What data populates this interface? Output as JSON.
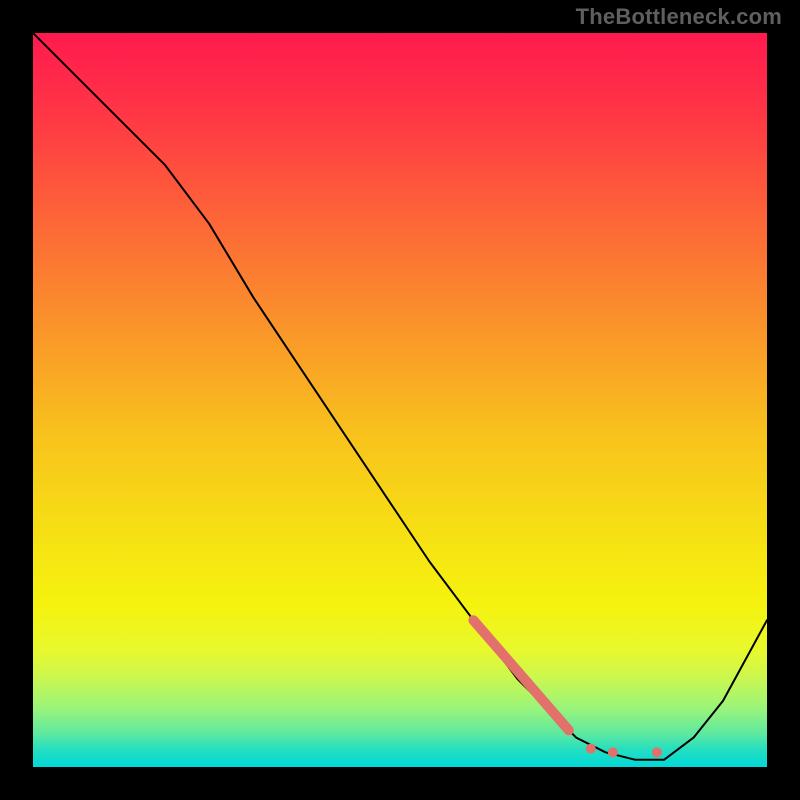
{
  "watermark": "TheBottleneck.com",
  "chart_data": {
    "type": "line",
    "title": "",
    "xlabel": "",
    "ylabel": "",
    "xlim": [
      0,
      100
    ],
    "ylim": [
      0,
      100
    ],
    "grid": false,
    "legend": false,
    "series": [
      {
        "name": "bottleneck-curve",
        "x": [
          0,
          4,
          10,
          18,
          24,
          30,
          36,
          42,
          48,
          54,
          60,
          66,
          70,
          74,
          78,
          82,
          86,
          90,
          94,
          100
        ],
        "y": [
          100,
          96,
          90,
          82,
          74,
          64,
          55,
          46,
          37,
          28,
          20,
          12,
          8,
          4,
          2,
          1,
          1,
          4,
          9,
          20
        ]
      }
    ],
    "markers": [
      {
        "name": "highlight-segment",
        "shape": "thick-line",
        "color": "#E2716C",
        "width": 10,
        "x": [
          60,
          73
        ],
        "y": [
          20,
          5
        ]
      },
      {
        "name": "highlight-dots",
        "shape": "dots",
        "color": "#E2716C",
        "radius": 5,
        "points": [
          {
            "x": 76,
            "y": 2.5
          },
          {
            "x": 79,
            "y": 2
          },
          {
            "x": 85,
            "y": 2
          }
        ]
      }
    ],
    "background_gradient": {
      "type": "vertical",
      "stops": [
        {
          "offset": 0.0,
          "color": "#FF1A4E"
        },
        {
          "offset": 0.1,
          "color": "#FF3346"
        },
        {
          "offset": 0.25,
          "color": "#FD6438"
        },
        {
          "offset": 0.4,
          "color": "#FA942A"
        },
        {
          "offset": 0.55,
          "color": "#F8C31C"
        },
        {
          "offset": 0.7,
          "color": "#F6E413"
        },
        {
          "offset": 0.78,
          "color": "#F5F30F"
        },
        {
          "offset": 0.84,
          "color": "#E8F82D"
        },
        {
          "offset": 0.88,
          "color": "#C9F751"
        },
        {
          "offset": 0.92,
          "color": "#9AF47A"
        },
        {
          "offset": 0.955,
          "color": "#5DE9A0"
        },
        {
          "offset": 0.975,
          "color": "#27DFBF"
        },
        {
          "offset": 1.0,
          "color": "#00D8D8"
        }
      ]
    }
  }
}
